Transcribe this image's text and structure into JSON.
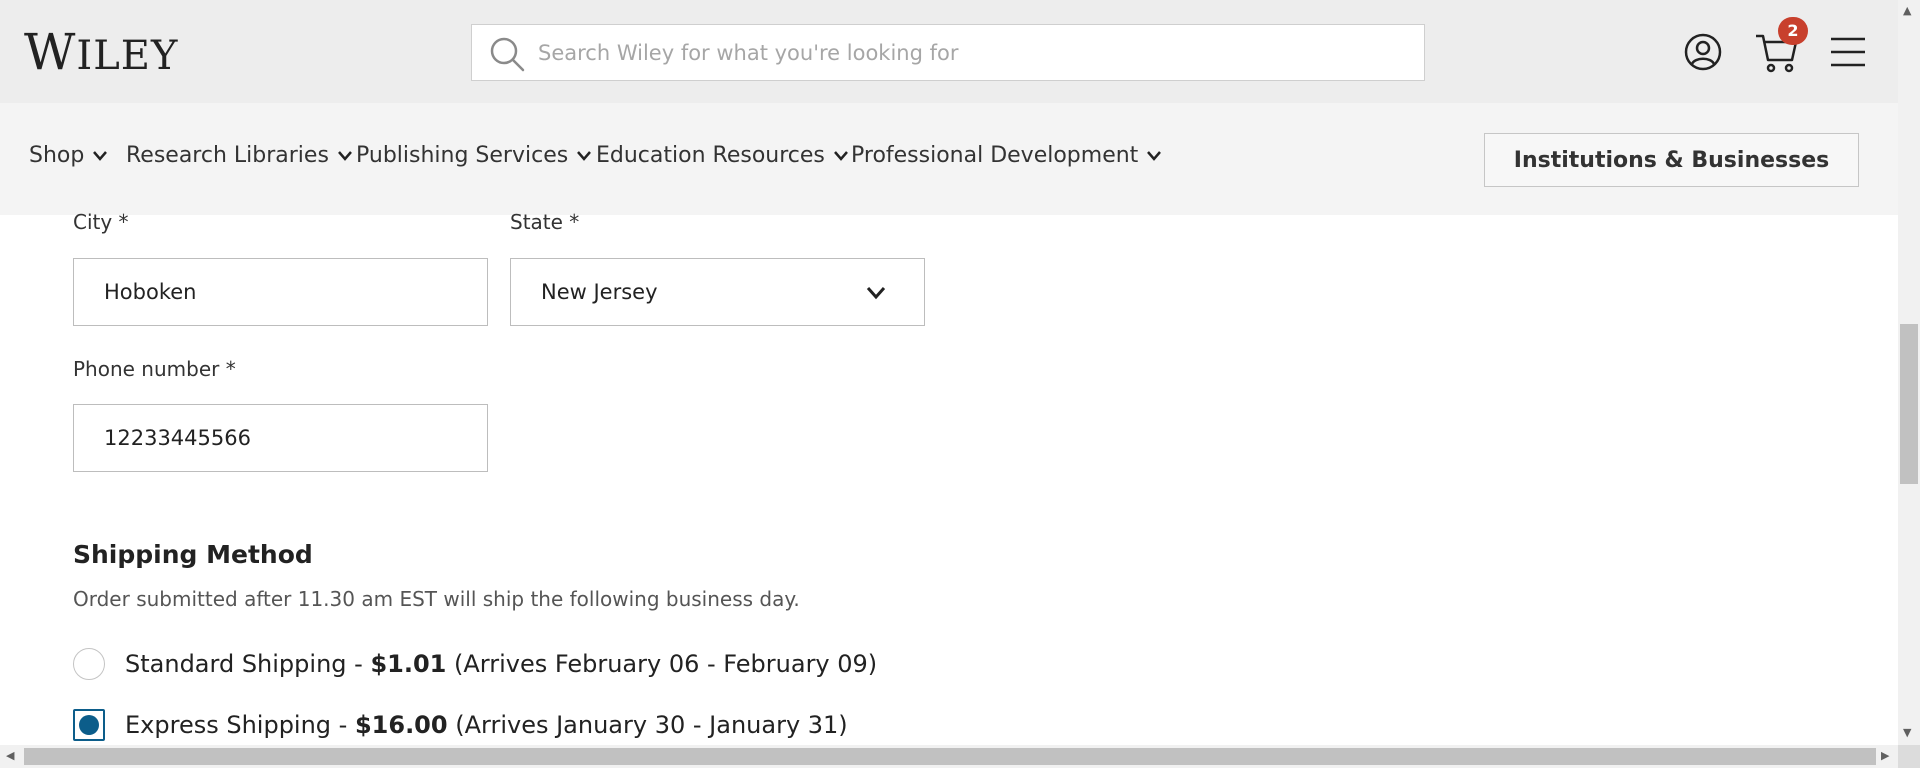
{
  "header": {
    "logo": {
      "first": "W",
      "rest": "ILEY"
    },
    "search": {
      "placeholder": "Search Wiley for what you're looking for"
    },
    "cart_count": "2"
  },
  "nav": {
    "items": [
      {
        "label": "Shop"
      },
      {
        "label": "Research Libraries"
      },
      {
        "label": "Publishing Services"
      },
      {
        "label": "Education Resources"
      },
      {
        "label": "Professional Development"
      }
    ],
    "institutions_button": "Institutions & Businesses"
  },
  "form": {
    "city": {
      "label": "City *",
      "value": "Hoboken"
    },
    "state": {
      "label": "State *",
      "value": "New Jersey"
    },
    "phone": {
      "label": "Phone number *",
      "value": "12233445566"
    }
  },
  "shipping": {
    "title": "Shipping Method",
    "note": "Order submitted after 11.30 am EST will ship the following business day.",
    "options": [
      {
        "name": "Standard Shipping - ",
        "price": "$1.01",
        "arrival": " (Arrives February 06 - February 09)",
        "selected": false
      },
      {
        "name": "Express Shipping - ",
        "price": "$16.00",
        "arrival": " (Arrives January 30 - January 31)",
        "selected": true
      }
    ]
  },
  "colors": {
    "header_bg": "#ededed",
    "nav_bg": "#f4f4f4",
    "cart_badge": "#c8402d",
    "radio_accent": "#0c5d8a"
  }
}
